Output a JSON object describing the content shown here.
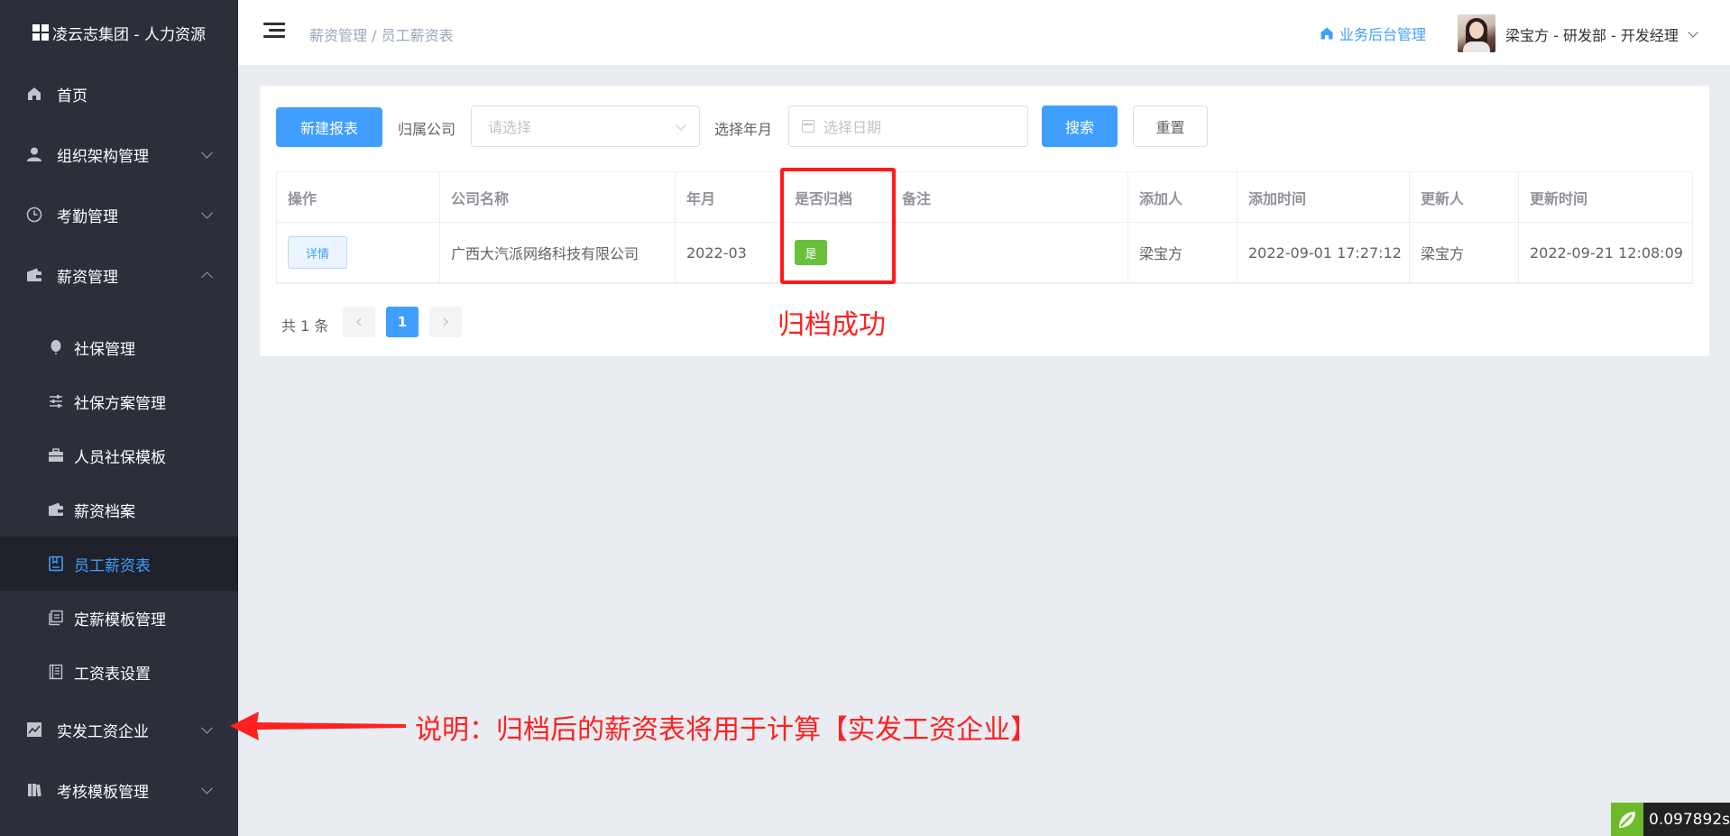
{
  "app": {
    "title": "凌云志集团 - 人力资源"
  },
  "sidebar": {
    "items": [
      {
        "label": "首页",
        "icon": "home-icon",
        "expandable": false
      },
      {
        "label": "组织架构管理",
        "icon": "user-icon",
        "expandable": true
      },
      {
        "label": "考勤管理",
        "icon": "clock-icon",
        "expandable": true
      },
      {
        "label": "薪资管理",
        "icon": "wallet-icon",
        "expandable": true,
        "expanded": true
      },
      {
        "label": "实发工资企业",
        "icon": "chart-icon",
        "expandable": true
      },
      {
        "label": "考核模板管理",
        "icon": "book-icon",
        "expandable": true
      }
    ],
    "sub_items": [
      {
        "label": "社保管理",
        "icon": "balloon-icon"
      },
      {
        "label": "社保方案管理",
        "icon": "sliders-icon"
      },
      {
        "label": "人员社保模板",
        "icon": "briefcase-icon"
      },
      {
        "label": "薪资档案",
        "icon": "wallet-icon"
      },
      {
        "label": "员工薪资表",
        "icon": "notebook-icon",
        "active": true
      },
      {
        "label": "定薪模板管理",
        "icon": "copy-icon"
      },
      {
        "label": "工资表设置",
        "icon": "document-icon"
      }
    ]
  },
  "header": {
    "breadcrumb": "薪资管理 / 员工薪资表",
    "biz_link": "业务后台管理",
    "user": "梁宝方 - 研发部 - 开发经理"
  },
  "toolbar": {
    "new_report": "新建报表",
    "company_label": "归属公司",
    "company_placeholder": "请选择",
    "month_label": "选择年月",
    "date_placeholder": "选择日期",
    "search": "搜索",
    "reset": "重置"
  },
  "table": {
    "columns": [
      "操作",
      "公司名称",
      "年月",
      "是否归档",
      "备注",
      "添加人",
      "添加时间",
      "更新人",
      "更新时间"
    ],
    "rows": [
      {
        "action": "详情",
        "company": "广西大汽派网络科技有限公司",
        "month": "2022-03",
        "archived": "是",
        "remark": "",
        "creator": "梁宝方",
        "created_at": "2022-09-01 17:27:12",
        "updater": "梁宝方",
        "updated_at": "2022-09-21 12:08:09"
      }
    ]
  },
  "pagination": {
    "total": "共 1 条",
    "current": "1"
  },
  "annotations": {
    "archive_success": "归档成功",
    "note": "说明：归档后的薪资表将用于计算【实发工资企业】"
  },
  "timing": "0.097892s",
  "colors": {
    "accent": "#409eff",
    "sidebar": "#2b2f3a",
    "success": "#67c23a",
    "annotation": "#ff2020"
  }
}
